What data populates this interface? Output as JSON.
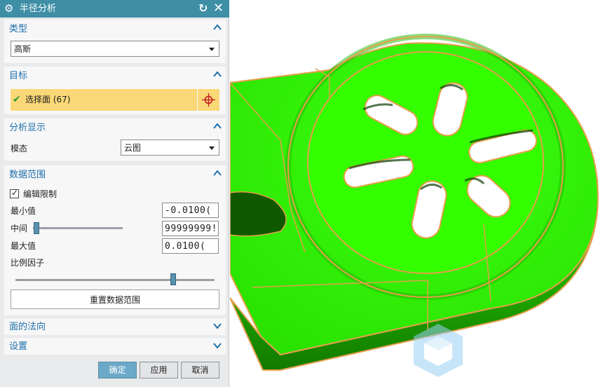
{
  "dialog": {
    "title": "半径分析",
    "icons": {
      "settings": "gear-icon",
      "reset": "reset-icon",
      "close": "close-icon"
    }
  },
  "sections": {
    "type": {
      "label": "类型",
      "value": "高斯"
    },
    "target": {
      "label": "目标",
      "selection_text": "选择面 (67)",
      "icons": [
        "check-icon",
        "crosshair-icon"
      ]
    },
    "display": {
      "label": "分析显示",
      "mode_label": "模态",
      "mode_value": "云图"
    },
    "data_range": {
      "label": "数据范围",
      "edit_limit_label": "编辑限制",
      "edit_limit_checked": true,
      "min_label": "最小值",
      "min_value": "-0.0100(",
      "mid_label": "中间",
      "mid_value": "99999999!",
      "mid_slider_fraction": 0.0,
      "max_label": "最大值",
      "max_value": "0.0100(",
      "scale_label": "比例因子",
      "scale_slider_fraction": 0.8,
      "reset_button": "重置数据范围"
    },
    "face_normal": {
      "label": "面的法向"
    },
    "settings": {
      "label": "设置"
    }
  },
  "footer": {
    "ok": "确定",
    "apply": "应用",
    "cancel": "取消"
  },
  "colors": {
    "titlebar": "#3e8ea6",
    "section_header": "#1c6fa8",
    "selection_bg": "#fad877",
    "model_fill": "#33ff00",
    "model_edge": "#e59e4a",
    "primary_button": "#6ca9c9"
  },
  "viewport": {
    "model": "green-surface-model",
    "orientation_icon": "view-cube-icon"
  }
}
